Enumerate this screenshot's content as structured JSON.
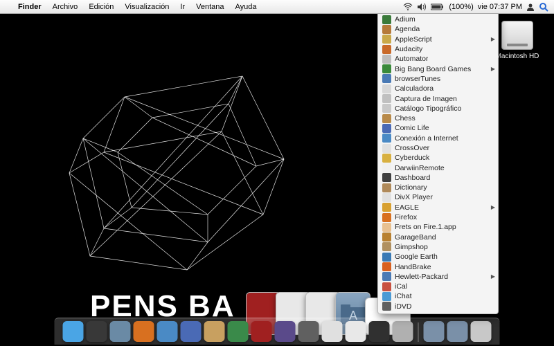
{
  "menubar": {
    "app": "Finder",
    "items": [
      "Archivo",
      "Edición",
      "Visualización",
      "Ir",
      "Ventana",
      "Ayuda"
    ],
    "battery": "(100%)",
    "clock": "vie 07:37 PM"
  },
  "desktop": {
    "hd_label": "Macintosh HD"
  },
  "applist": [
    {
      "label": "Adium",
      "color": "#3a7a3a",
      "submenu": false
    },
    {
      "label": "Agenda",
      "color": "#b57a3a",
      "submenu": false
    },
    {
      "label": "AppleScript",
      "color": "#c9a94a",
      "submenu": true
    },
    {
      "label": "Audacity",
      "color": "#c96a2a",
      "submenu": false
    },
    {
      "label": "Automator",
      "color": "#bdbdbd",
      "submenu": false
    },
    {
      "label": "Big Bang Board Games",
      "color": "#3a8a3a",
      "submenu": true
    },
    {
      "label": "browserTunes",
      "color": "#4a7ab5",
      "submenu": false
    },
    {
      "label": "Calculadora",
      "color": "#d8d8d8",
      "submenu": false
    },
    {
      "label": "Captura de Imagen",
      "color": "#c0c0c0",
      "submenu": false
    },
    {
      "label": "Catálogo Tipográfico",
      "color": "#c8c8c8",
      "submenu": false
    },
    {
      "label": "Chess",
      "color": "#b88a4a",
      "submenu": false
    },
    {
      "label": "Comic Life",
      "color": "#4a6ab5",
      "submenu": false
    },
    {
      "label": "Conexión a Internet",
      "color": "#4a8ac5",
      "submenu": false
    },
    {
      "label": "CrossOver",
      "color": "#e0e0e0",
      "submenu": false
    },
    {
      "label": "Cyberduck",
      "color": "#d8b040",
      "submenu": false
    },
    {
      "label": "DarwiinRemote",
      "color": "#f0f0f0",
      "submenu": false
    },
    {
      "label": "Dashboard",
      "color": "#404040",
      "submenu": false
    },
    {
      "label": "Dictionary",
      "color": "#b08a5a",
      "submenu": false
    },
    {
      "label": "DivX Player",
      "color": "#e0e0e0",
      "submenu": false
    },
    {
      "label": "EAGLE",
      "color": "#d8a030",
      "submenu": true
    },
    {
      "label": "Firefox",
      "color": "#d87020",
      "submenu": false
    },
    {
      "label": "Frets on Fire.1.app",
      "color": "#e8c090",
      "submenu": false
    },
    {
      "label": "GarageBand",
      "color": "#b88030",
      "submenu": false
    },
    {
      "label": "Gimpshop",
      "color": "#b09060",
      "submenu": false
    },
    {
      "label": "Google Earth",
      "color": "#3a7ab5",
      "submenu": false
    },
    {
      "label": "HandBrake",
      "color": "#d86020",
      "submenu": false
    },
    {
      "label": "Hewlett-Packard",
      "color": "#4a7ab5",
      "submenu": true
    },
    {
      "label": "iCal",
      "color": "#c85040",
      "submenu": false
    },
    {
      "label": "iChat",
      "color": "#4a9ad5",
      "submenu": false
    },
    {
      "label": "iDVD",
      "color": "#606060",
      "submenu": false
    }
  ],
  "watermark": "PENS BA",
  "dock": {
    "items": [
      {
        "name": "finder",
        "color": "#4aa5e5"
      },
      {
        "name": "dashboard",
        "color": "#383838"
      },
      {
        "name": "google-earth",
        "color": "#6a8aa5"
      },
      {
        "name": "firefox",
        "color": "#d87020"
      },
      {
        "name": "safari",
        "color": "#4a8ac5"
      },
      {
        "name": "comic-life",
        "color": "#4a6ab5"
      },
      {
        "name": "mail",
        "color": "#c8a060"
      },
      {
        "name": "itunes",
        "color": "#3a8a4a"
      },
      {
        "name": "photo-booth",
        "color": "#a02020"
      },
      {
        "name": "imovie",
        "color": "#5a4a8a"
      },
      {
        "name": "idvd",
        "color": "#606060"
      },
      {
        "name": "ical",
        "color": "#e0e0e0"
      },
      {
        "name": "textedit",
        "color": "#e8e8e8"
      },
      {
        "name": "terminal",
        "color": "#303030"
      },
      {
        "name": "system-prefs",
        "color": "#b0b0b0"
      }
    ]
  }
}
